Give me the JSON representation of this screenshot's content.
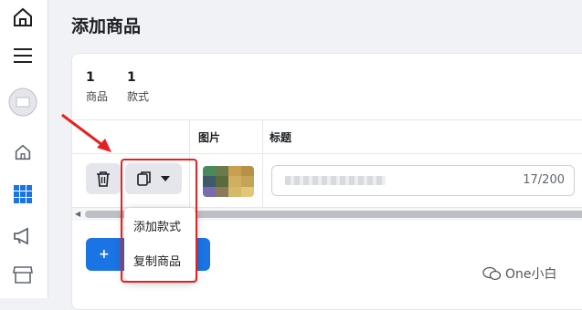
{
  "page": {
    "title": "添加商品"
  },
  "stats": [
    {
      "value": "1",
      "label": "商品"
    },
    {
      "value": "1",
      "label": "款式"
    }
  ],
  "table": {
    "columns": [
      "图片",
      "标题"
    ],
    "rows": [
      {
        "title_counter": "17/200"
      }
    ]
  },
  "add_button": {
    "label": "+"
  },
  "dropdown_menu": {
    "items": [
      "添加款式",
      "复制商品"
    ]
  },
  "watermark": {
    "text": "One小白"
  },
  "colors": {
    "accent": "#1b74e4",
    "highlight": "#e62020"
  }
}
